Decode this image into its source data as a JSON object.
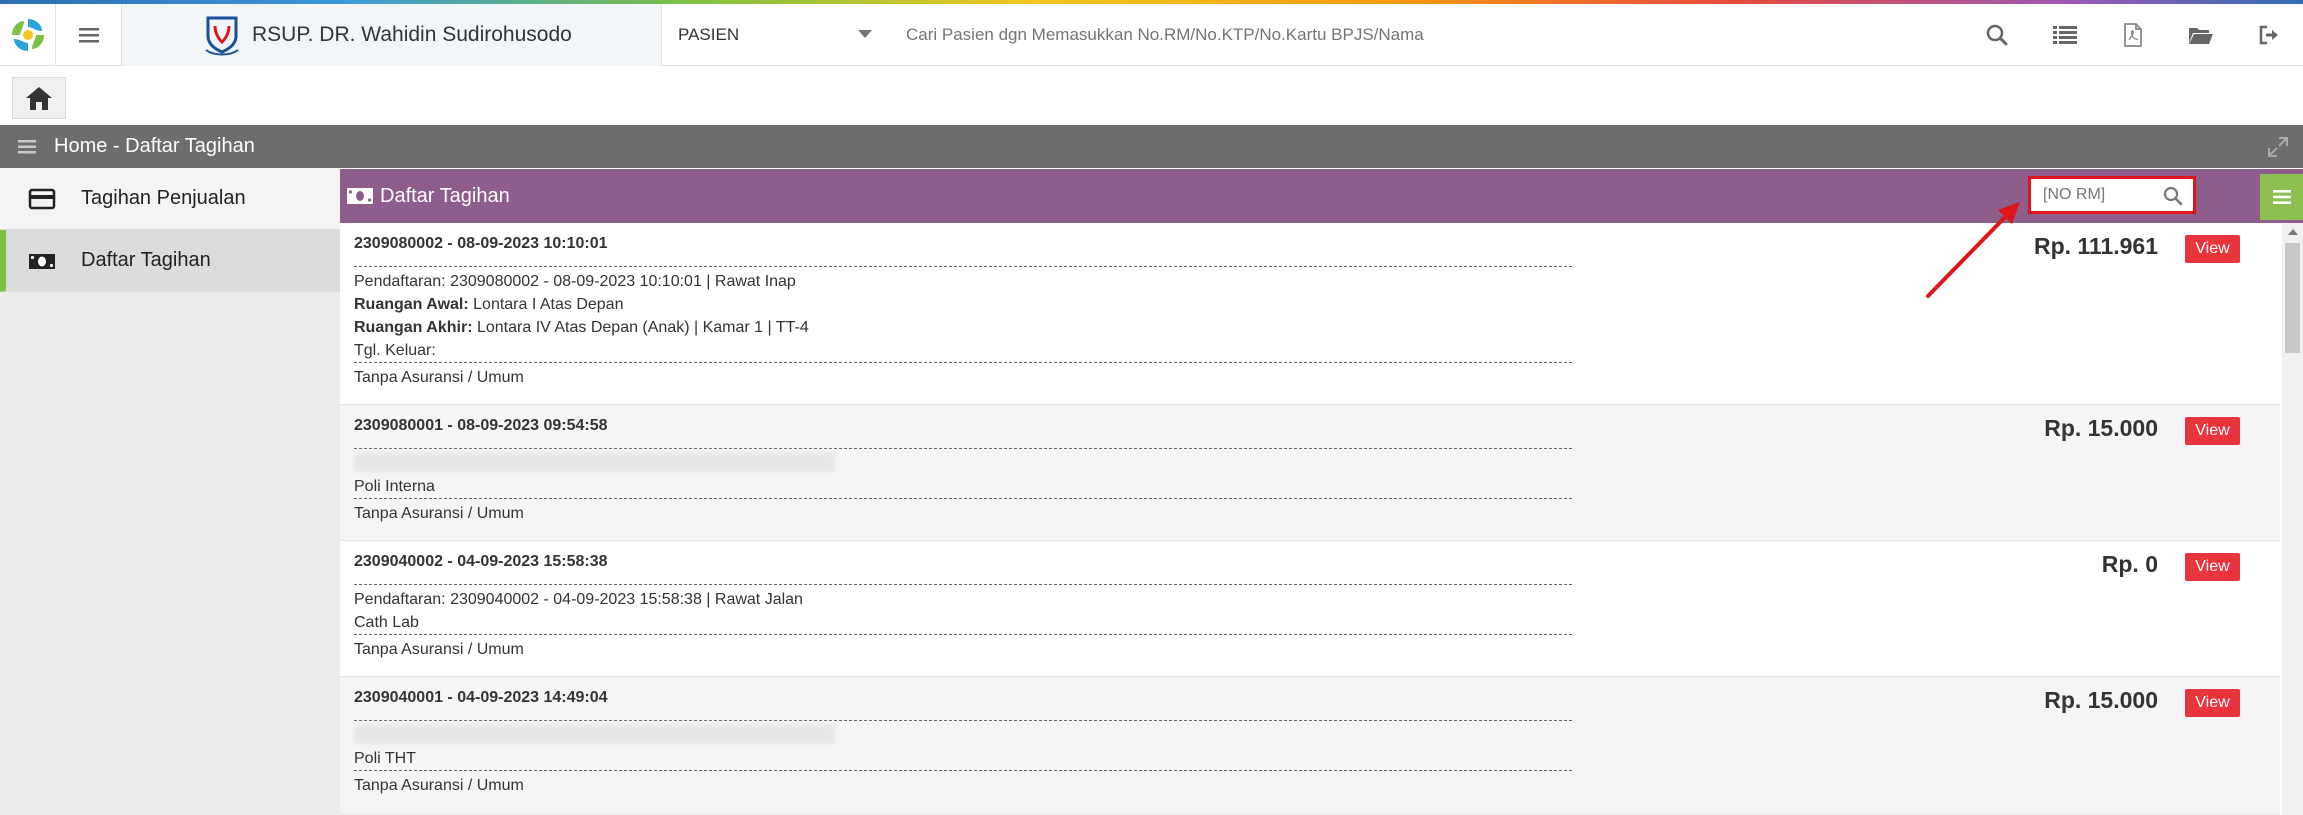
{
  "topbar": {
    "hospital_name": "RSUP. DR. Wahidin Sudirohusodo",
    "patient_select": "PASIEN",
    "search_placeholder": "Cari Pasien dgn Memasukkan No.RM/No.KTP/No.Kartu BPJS/Nama",
    "icons": [
      "search-icon",
      "list-icon",
      "pdf-icon",
      "folder-open-icon",
      "logout-icon"
    ]
  },
  "breadcrumb": {
    "text": "Home - Daftar Tagihan"
  },
  "sidebar": {
    "items": [
      {
        "label": "Tagihan Penjualan",
        "icon": "credit-card-icon",
        "active": false
      },
      {
        "label": "Daftar Tagihan",
        "icon": "money-icon",
        "active": true
      }
    ]
  },
  "panel": {
    "title": "Daftar Tagihan",
    "rm_placeholder": "[NO RM]"
  },
  "bills": [
    {
      "header": "2309080002 - 08-09-2023 10:10:01",
      "amount": "Rp. 111.961",
      "view_label": "View",
      "registration": "Pendaftaran: 2309080002 - 08-09-2023 10:10:01 | Rawat Inap",
      "ruangan_awal_label": "Ruangan Awal:",
      "ruangan_awal": "Lontara I Atas Depan",
      "ruangan_akhir_label": "Ruangan Akhir:",
      "ruangan_akhir": "Lontara IV Atas Depan (Anak) | Kamar 1 | TT-4",
      "tgl_keluar": "Tgl. Keluar:",
      "insurance": "Tanpa Asuransi / Umum"
    },
    {
      "header": "2309080001 - 08-09-2023 09:54:58",
      "amount": "Rp. 15.000",
      "view_label": "View",
      "unit": "Poli Interna",
      "insurance": "Tanpa Asuransi / Umum"
    },
    {
      "header": "2309040002 - 04-09-2023 15:58:38",
      "amount": "Rp. 0",
      "view_label": "View",
      "registration": "Pendaftaran: 2309040002 - 04-09-2023 15:58:38 | Rawat Jalan",
      "unit": "Cath Lab",
      "insurance": "Tanpa Asuransi / Umum"
    },
    {
      "header": "2309040001 - 04-09-2023 14:49:04",
      "amount": "Rp. 15.000",
      "view_label": "View",
      "unit": "Poli THT",
      "insurance": "Tanpa Asuransi / Umum"
    }
  ],
  "colors": {
    "panel_header": "#8f5d8b",
    "breadcrumb_bar": "#6e6c6c",
    "view_button": "#e8353d",
    "menu_button": "#8cc152",
    "annotation": "#e0141b"
  }
}
